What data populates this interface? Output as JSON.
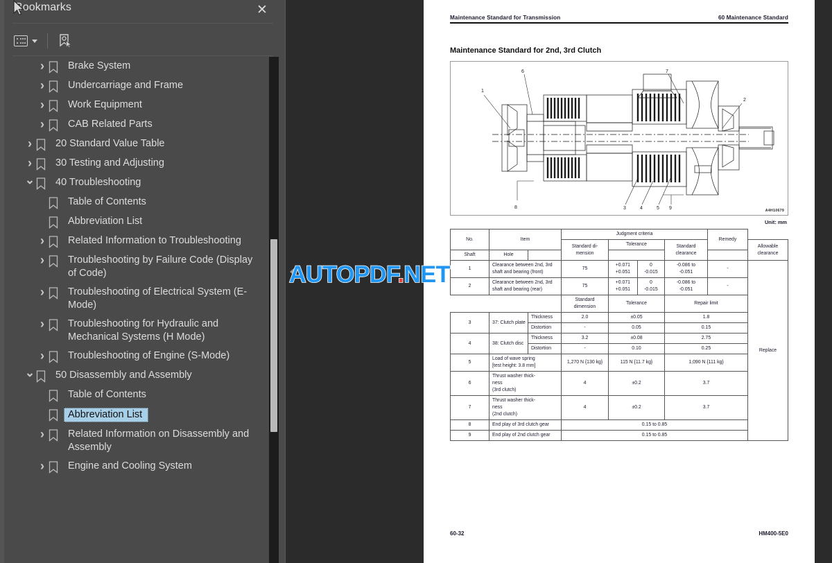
{
  "sidebar": {
    "title": "Bookmarks",
    "close_label": "✕",
    "toolbar": {
      "options_icon": "list-options-icon",
      "dropdown_icon": "chevron-down-icon",
      "new_bookmark_icon": "new-bookmark-icon"
    },
    "items": [
      {
        "label": "Brake System",
        "level": 1,
        "state": "collapsed",
        "selected": false
      },
      {
        "label": "Undercarriage and Frame",
        "level": 1,
        "state": "collapsed",
        "selected": false
      },
      {
        "label": "Work Equipment",
        "level": 1,
        "state": "collapsed",
        "selected": false
      },
      {
        "label": "CAB Related Parts",
        "level": 1,
        "state": "collapsed",
        "selected": false
      },
      {
        "label": "20 Standard Value Table",
        "level": 0,
        "state": "collapsed",
        "selected": false
      },
      {
        "label": "30 Testing and Adjusting",
        "level": 0,
        "state": "collapsed",
        "selected": false
      },
      {
        "label": "40 Troubleshooting",
        "level": 0,
        "state": "expanded",
        "selected": false
      },
      {
        "label": "Table of Contents",
        "level": 1,
        "state": "none",
        "selected": false
      },
      {
        "label": "Abbreviation List",
        "level": 1,
        "state": "none",
        "selected": false
      },
      {
        "label": "Related Information to Troubleshooting",
        "level": 1,
        "state": "collapsed",
        "selected": false
      },
      {
        "label": "Troubleshooting by Failure Code (Display of Code)",
        "level": 1,
        "state": "collapsed",
        "selected": false
      },
      {
        "label": "Troubleshooting of Electrical System (E-Mode)",
        "level": 1,
        "state": "collapsed",
        "selected": false
      },
      {
        "label": "Troubleshooting for Hydraulic and Mechanical Systems (H Mode)",
        "level": 1,
        "state": "collapsed",
        "selected": false
      },
      {
        "label": "Troubleshooting of Engine (S-Mode)",
        "level": 1,
        "state": "collapsed",
        "selected": false
      },
      {
        "label": "50 Disassembly and Assembly",
        "level": 0,
        "state": "expanded",
        "selected": false
      },
      {
        "label": "Table of Contents",
        "level": 1,
        "state": "none",
        "selected": false
      },
      {
        "label": "Abbreviation List",
        "level": 1,
        "state": "none",
        "selected": true
      },
      {
        "label": "Related Information on Disassembly and Assembly",
        "level": 1,
        "state": "collapsed",
        "selected": false
      },
      {
        "label": "Engine and Cooling System",
        "level": 1,
        "state": "collapsed",
        "selected": false
      }
    ]
  },
  "viewer": {
    "collapse_handle_icon": "collapse-panel-icon",
    "watermark": {
      "text_main": "AUTOPDF",
      "text_dot": ".",
      "text_tld": "NET"
    }
  },
  "page": {
    "header_left": "Maintenance Standard for Transmission",
    "header_right": "60 Maintenance Standard",
    "title": "Maintenance Standard for 2nd, 3rd Clutch",
    "figure_code": "A4H10679",
    "figure_callouts": [
      "1",
      "2",
      "3",
      "4",
      "5",
      "6",
      "7",
      "8",
      "9"
    ],
    "unit_label": "Unit: mm",
    "footer_left": "60-32",
    "footer_right": "HM400-5E0"
  },
  "table": {
    "headers": {
      "no": "No.",
      "item": "Item",
      "judgment": "Judgment criteria",
      "remedy": "Remedy",
      "standard_dimension_wrapped": "Standard di-\nmension",
      "tolerance": "Tolerance",
      "shaft": "Shaft",
      "hole": "Hole",
      "standard_clearance": "Standard\nclearance",
      "allowable_clearance": "Allowable\nclearance",
      "standard_dimension": "Standard dimension",
      "repair_limit": "Repair limit"
    },
    "rows": [
      {
        "no": "1",
        "item": "Clearance between 2nd, 3rd shaft and bearing (front)",
        "std_dim": "75",
        "shaft": "+0.071\n+0.051",
        "hole": "0\n-0.015",
        "std_clearance": "-0.086 to\n-0.051",
        "allow_clearance": "-"
      },
      {
        "no": "2",
        "item": "Clearance between 2nd, 3rd shaft and bearing (rear)",
        "std_dim": "75",
        "shaft": "+0.071\n+0.051",
        "hole": "0\n-0.015",
        "std_clearance": "-0.086 to\n-0.051",
        "allow_clearance": "-"
      },
      {
        "no": "3",
        "item": "37: Clutch plate",
        "sub": [
          {
            "label": "Thickness",
            "std_dim": "2.0",
            "tolerance": "±0.05",
            "repair_limit": "1.8"
          },
          {
            "label": "Distortion",
            "std_dim": "-",
            "tolerance": "0.05",
            "repair_limit": "0.15"
          }
        ]
      },
      {
        "no": "4",
        "item": "38: Clutch disc",
        "sub": [
          {
            "label": "Thickness",
            "std_dim": "3.2",
            "tolerance": "±0.08",
            "repair_limit": "2.75"
          },
          {
            "label": "Distortion",
            "std_dim": "-",
            "tolerance": "0.10",
            "repair_limit": "0.25"
          }
        ]
      },
      {
        "no": "5",
        "item": "Load of wave spring\n[test height: 3.8 mm]",
        "std_dim": "1,270 N {130 kg}",
        "tolerance": "115 N {11.7 kg}",
        "repair_limit": "1,090 N {111 kg}"
      },
      {
        "no": "6",
        "item": "Thrust washer thick-\nness\n(3rd clutch)",
        "std_dim": "4",
        "tolerance": "±0.2",
        "repair_limit": "3.7"
      },
      {
        "no": "7",
        "item": "Thrust washer thick-\nness\n(2nd clutch)",
        "std_dim": "4",
        "tolerance": "±0.2",
        "repair_limit": "3.7"
      },
      {
        "no": "8",
        "item": "End play of 3rd clutch gear",
        "span_value": "0.15 to 0.85"
      },
      {
        "no": "9",
        "item": "End play of 2nd clutch gear",
        "span_value": "0.15 to 0.85"
      }
    ],
    "remedy_value": "Replace"
  }
}
